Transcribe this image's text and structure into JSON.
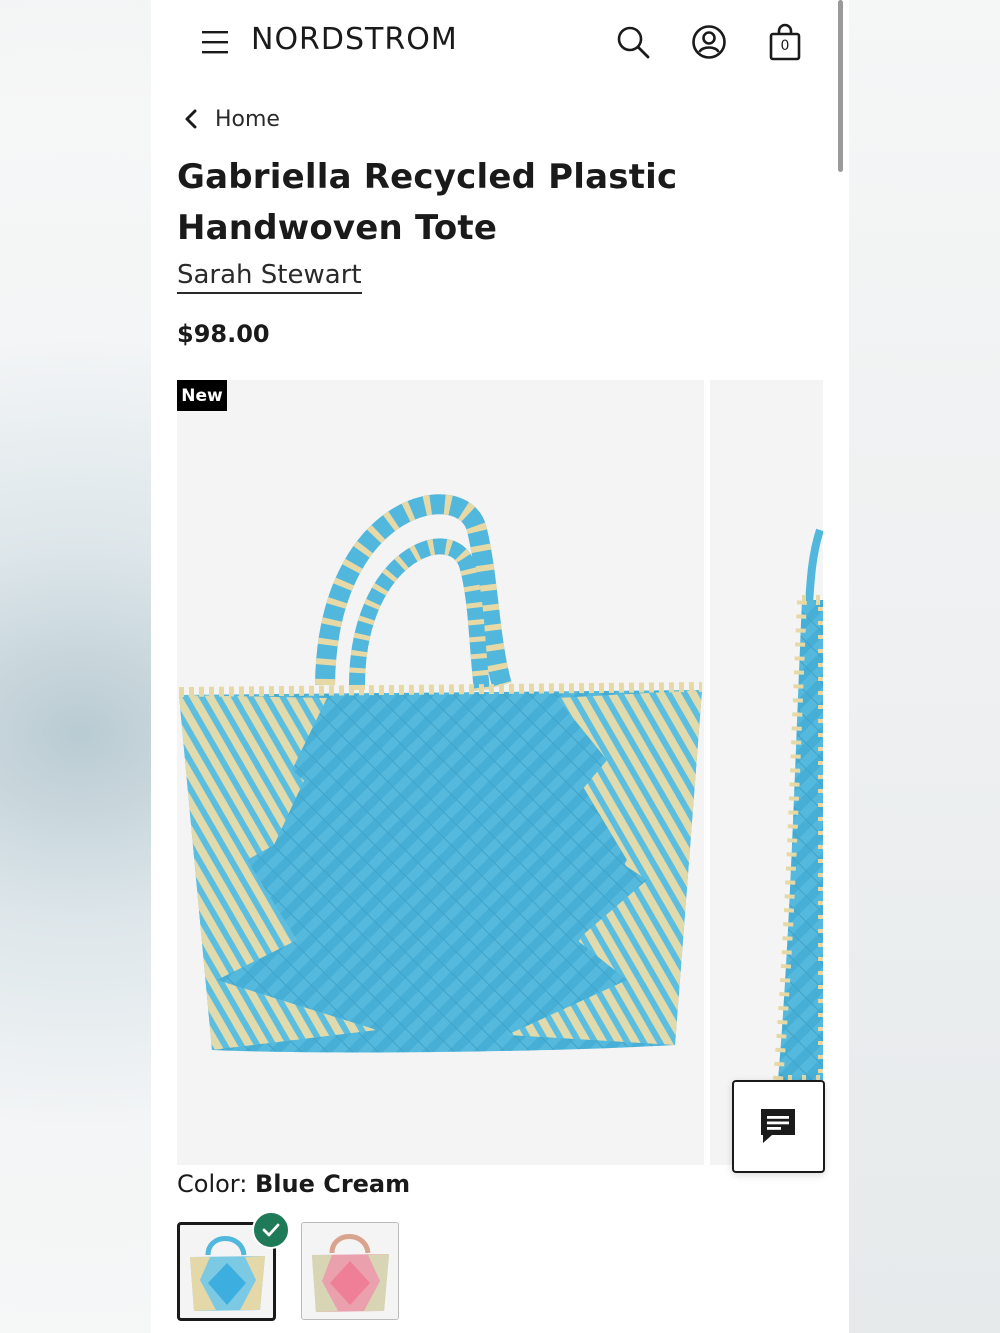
{
  "header": {
    "brand_logo": "NORDSTROM",
    "bag_count": "0"
  },
  "icons": {
    "menu": "menu-icon",
    "search": "search-icon",
    "account": "account-icon",
    "bag": "shopping-bag-icon",
    "back": "chevron-left-icon",
    "chat": "chat-icon",
    "selected": "check-icon"
  },
  "breadcrumb": {
    "label": "Home"
  },
  "product": {
    "title": "Gabriella Recycled Plastic Handwoven Tote",
    "brand": "Sarah Stewart",
    "price": "$98.00",
    "badge": "New",
    "color_label": "Color:",
    "color_value": "Blue Cream"
  },
  "swatches": [
    {
      "name": "Blue Cream",
      "selected": true,
      "color": "#4fb8dc",
      "accent": "#e7d9a6"
    },
    {
      "name": "Pink",
      "selected": false,
      "color": "#e98ea0",
      "accent": "#d8d7b4"
    }
  ],
  "colors": {
    "badge_bg": "#000000",
    "check_badge": "#1f7a57",
    "tote_blue": "#4fb8dc",
    "tote_cream": "#e7d9a6"
  }
}
